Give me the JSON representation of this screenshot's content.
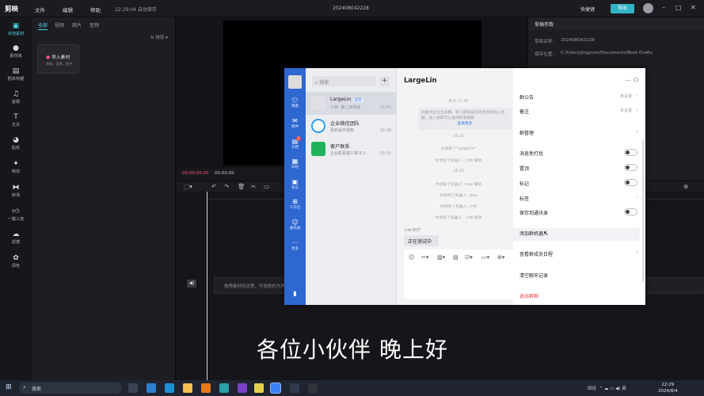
{
  "app": {
    "logo_text": "剪映",
    "menus": [
      "文件",
      "编辑",
      "帮助"
    ],
    "autosave_text": "22:29:04 自动保存",
    "project_title": "202408042228",
    "shortcut_label": "快捷键",
    "export_label": "导出"
  },
  "rail": [
    {
      "label": "本地素材",
      "icon": "media-icon"
    },
    {
      "label": "素材库",
      "icon": "library-icon"
    },
    {
      "label": "剧本热梗",
      "icon": "script-icon"
    },
    {
      "label": "音频",
      "icon": "audio-icon"
    },
    {
      "label": "文本",
      "icon": "text-icon"
    },
    {
      "label": "贴纸",
      "icon": "sticker-icon"
    },
    {
      "label": "特效",
      "icon": "effects-icon"
    },
    {
      "label": "转场",
      "icon": "transition-icon"
    },
    {
      "label": "一键三连",
      "icon": "like-icon"
    },
    {
      "label": "滤镜",
      "icon": "filter-icon"
    },
    {
      "label": "调色",
      "icon": "color-icon"
    }
  ],
  "media": {
    "tabs": [
      "全部",
      "视频",
      "图片",
      "音频"
    ],
    "sort_label": "排序",
    "import_title": "导入素材",
    "import_sub": "视频、音频、图片"
  },
  "player": {
    "current_time": "00:00:00.00",
    "total_time": "00:00:00"
  },
  "props": {
    "header": "草稿参数",
    "rows": [
      {
        "key": "草稿名称:",
        "value": "202408042228"
      },
      {
        "key": "保存位置:",
        "value": "C:/Users/jingyixin/Documents/Boot Drafts"
      }
    ]
  },
  "timeline": {
    "hint": "拖拽素材到这里，开始你的大作吧"
  },
  "subtitle": "各位小伙伴 晚上好",
  "wecom": {
    "nav": [
      {
        "label": "消息",
        "icon": "message-icon"
      },
      {
        "label": "邮件",
        "icon": "mail-icon"
      },
      {
        "label": "文档",
        "icon": "doc-icon",
        "badge": "2"
      },
      {
        "label": "日程",
        "icon": "calendar-icon"
      },
      {
        "label": "会议",
        "icon": "meeting-icon"
      },
      {
        "label": "工作台",
        "icon": "workbench-icon"
      },
      {
        "label": "通讯录",
        "icon": "contacts-icon"
      },
      {
        "label": "更多",
        "icon": "more-icon"
      }
    ],
    "search_placeholder": "搜索",
    "conversations": [
      {
        "name": "LargeLin",
        "tag": "全员",
        "preview": "小林: 第二次测试",
        "time": "16:40",
        "color": "#dfe1e6"
      },
      {
        "name": "企业微信团队",
        "preview": "更新操作通知",
        "time": "16:08",
        "color": "#2f9cf0"
      },
      {
        "name": "客户联系",
        "preview": "企业联系客户端 8.2",
        "time": "09:50",
        "color": "#21b35b"
      }
    ],
    "chat": {
      "title": "LargeLin",
      "time1": "昨天 17:43",
      "notice": "此群为企业全员群，新入职的成员将会自动加入此群。加入后即可以查阅所有群聊",
      "notice_link": "查看更多",
      "msgs": [
        "16:20",
        "你移除了\"LargeLin\"",
        "你添加了机器人 · 小林 撤销",
        "16:33",
        "你添加了机器人: xiao 撤销",
        "你移除了机器人: xiao",
        "你移除了机器人: 小林",
        "你添加了机器人 · 小林 撤销"
      ],
      "sender": "小林 BOT",
      "bubble": "正在测试中"
    },
    "panel": [
      {
        "label": "群公告",
        "value": "未设置",
        "kind": "arrow"
      },
      {
        "label": "备注",
        "value": "未设置",
        "kind": "arrow"
      },
      {
        "label": "群管理",
        "value": "",
        "kind": "arrow"
      },
      {
        "label": "消息免打扰",
        "kind": "toggle"
      },
      {
        "label": "置顶",
        "kind": "toggle"
      },
      {
        "label": "标记",
        "kind": "toggle"
      },
      {
        "label": "标签",
        "value": "",
        "kind": "arrow"
      },
      {
        "label": "保存到通讯录",
        "kind": "toggle"
      },
      {
        "label": "添加群机器人",
        "value": "",
        "kind": "arrow"
      },
      {
        "label": "查看群成员日程",
        "value": "",
        "kind": "arrow"
      },
      {
        "label": "清空聊天记录",
        "kind": "none"
      },
      {
        "label": "退出群聊",
        "kind": "danger"
      }
    ]
  },
  "taskbar": {
    "search_placeholder": "搜索",
    "tray_text": "田径",
    "ime": "英",
    "time": "22:29",
    "date": "2024/8/4"
  }
}
